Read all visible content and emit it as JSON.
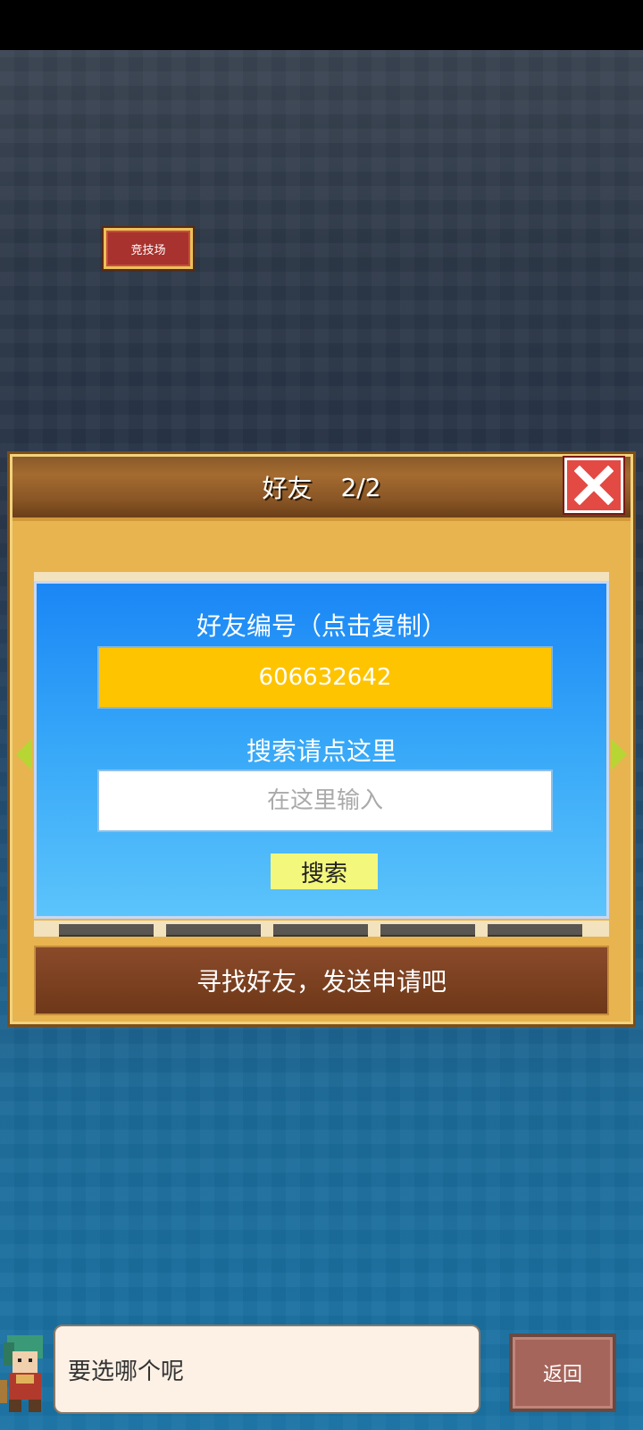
{
  "map": {
    "arena_label": "竞技场"
  },
  "dialog": {
    "title": "好友",
    "count": "2/2",
    "panel_title": "好友编号（点击复制）",
    "friend_id": "606632642",
    "search_label": "搜索请点这里",
    "search_placeholder": "在这里输入",
    "search_button": "搜索",
    "footer_text": "寻找好友，发送申请吧"
  },
  "bottom": {
    "speech_text": "要选哪个呢",
    "back_label": "返回"
  },
  "colors": {
    "id_box": "#fec400",
    "panel_top": "#1a86f5",
    "close_button": "#e34a44",
    "arrow": "#b7d634"
  },
  "icons": [
    "close-icon",
    "arrow-left-icon",
    "arrow-right-icon",
    "character-avatar-icon"
  ]
}
